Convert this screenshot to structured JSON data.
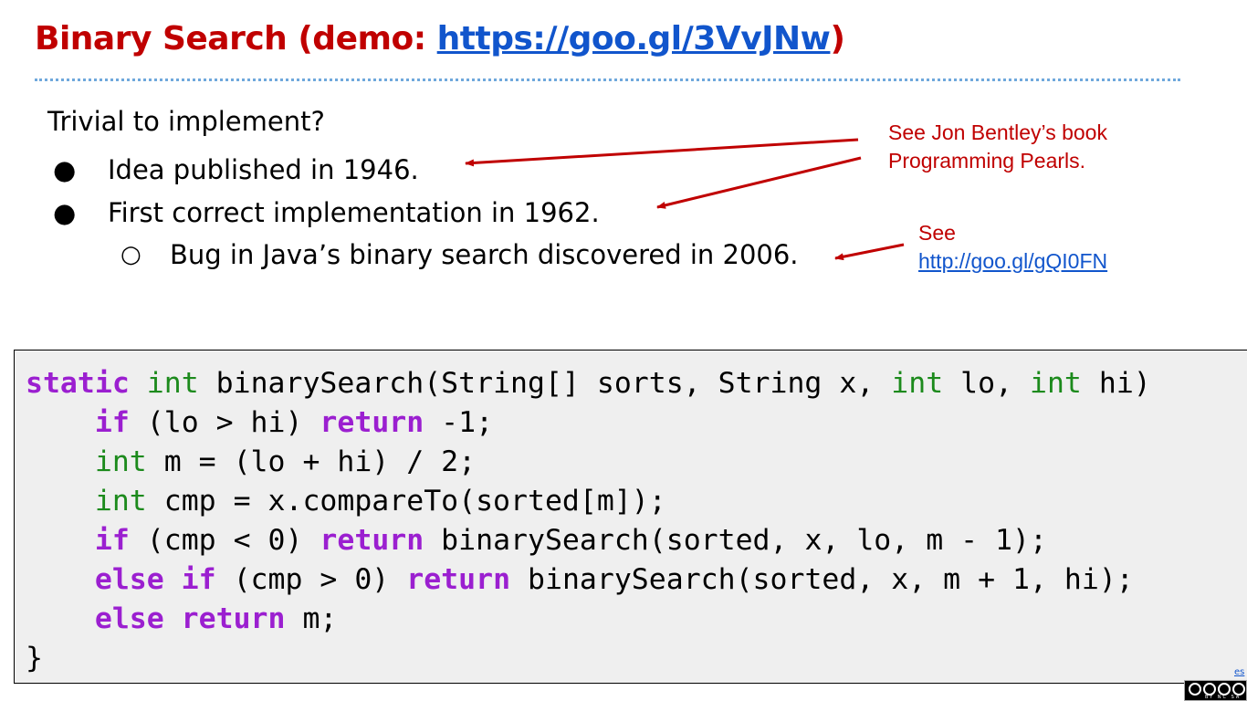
{
  "slide": {
    "title_prefix": "Binary Search (demo: ",
    "title_link": "https://goo.gl/3VvJNw",
    "title_suffix": ")",
    "lead": "Trivial to implement?",
    "bullets": [
      {
        "marker": "●",
        "text": "Idea published in 1946."
      },
      {
        "marker": "●",
        "text": "First correct implementation in 1962."
      },
      {
        "marker": "○",
        "text": "Bug in Java’s binary search discovered in 2006."
      }
    ],
    "note1": {
      "line1": "See Jon Bentley’s book",
      "line2": "Programming Pearls."
    },
    "note2": {
      "line1": "See",
      "link": "http://goo.gl/gQI0FN"
    },
    "corner_link": "es"
  },
  "code_lines": [
    [
      [
        "kw",
        "static"
      ],
      [
        "t",
        " "
      ],
      [
        "ty",
        "int"
      ],
      [
        "t",
        " binarySearch(String[] sorts, String x, "
      ],
      [
        "ty",
        "int"
      ],
      [
        "t",
        " lo, "
      ],
      [
        "ty",
        "int"
      ],
      [
        "t",
        " hi)"
      ]
    ],
    [
      [
        "t",
        "    "
      ],
      [
        "kw",
        "if"
      ],
      [
        "t",
        " (lo > hi) "
      ],
      [
        "kw",
        "return"
      ],
      [
        "t",
        " -1;"
      ]
    ],
    [
      [
        "t",
        "    "
      ],
      [
        "ty",
        "int"
      ],
      [
        "t",
        " m = (lo + hi) / 2;"
      ]
    ],
    [
      [
        "t",
        "    "
      ],
      [
        "ty",
        "int"
      ],
      [
        "t",
        " cmp = x.compareTo(sorted[m]);"
      ]
    ],
    [
      [
        "t",
        "    "
      ],
      [
        "kw",
        "if"
      ],
      [
        "t",
        " (cmp < 0) "
      ],
      [
        "kw",
        "return"
      ],
      [
        "t",
        " binarySearch(sorted, x, lo, m - 1);"
      ]
    ],
    [
      [
        "t",
        "    "
      ],
      [
        "kw",
        "else if"
      ],
      [
        "t",
        " (cmp > 0) "
      ],
      [
        "kw",
        "return"
      ],
      [
        "t",
        " binarySearch(sorted, x, m + 1, hi);"
      ]
    ],
    [
      [
        "t",
        "    "
      ],
      [
        "kw",
        "else return"
      ],
      [
        "t",
        " m;"
      ]
    ],
    [
      [
        "t",
        "}"
      ]
    ]
  ],
  "colors": {
    "title_red": "#c00000",
    "link_blue": "#1155cc",
    "divider_blue": "#6fa8dc",
    "keyword_purple": "#9b1fd0",
    "type_green": "#1c8a1c",
    "code_bg": "#efefef"
  },
  "license_badge": {
    "icon": "cc-by-nc-sa-icon",
    "text": "BY NC SA"
  }
}
